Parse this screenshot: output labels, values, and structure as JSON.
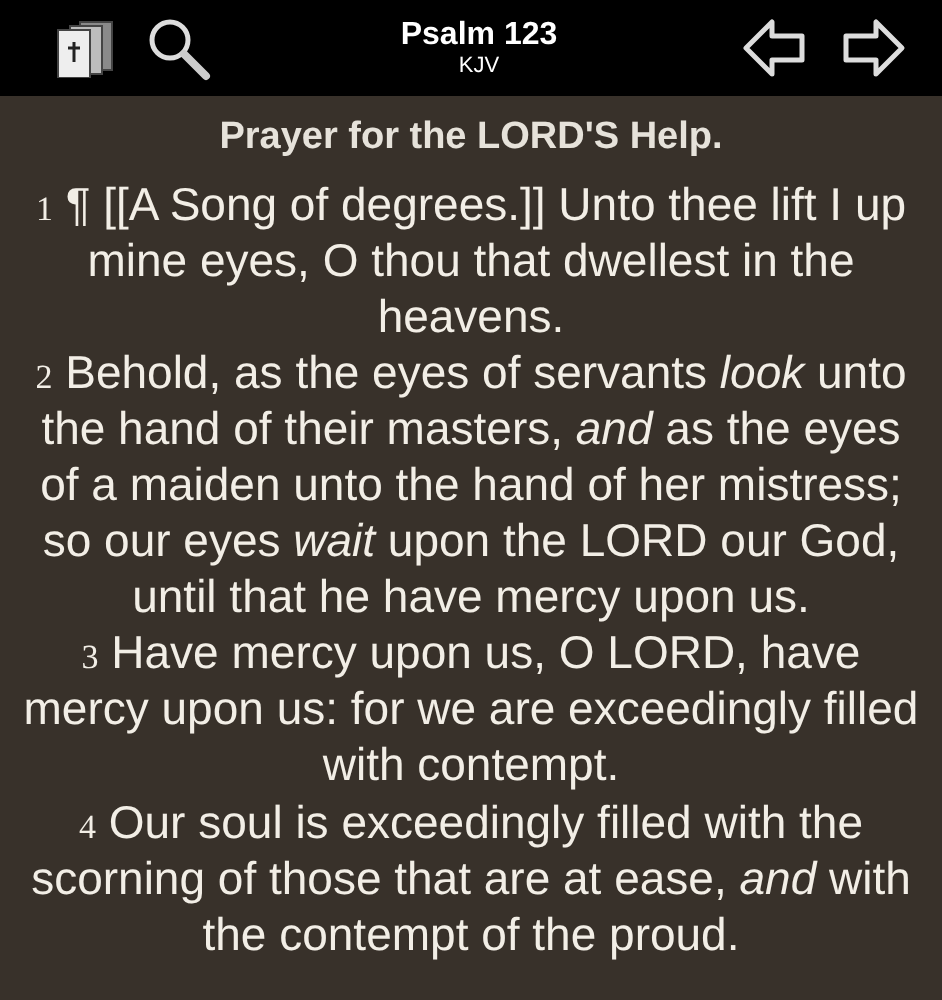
{
  "header": {
    "title": "Psalm 123",
    "subtitle": "KJV"
  },
  "heading": "Prayer for the LORD'S Help.",
  "verses": [
    {
      "number": "1",
      "text": "¶ [[A Song of degrees.]] Unto thee lift I up mine eyes, O thou that dwellest in the heavens."
    },
    {
      "number": "2",
      "text": "Behold, as the eyes of servants *look* unto the hand of their masters, *and* as the eyes of a maiden unto the hand of her mistress; so our eyes *wait* upon the LORD our God, until that he have mercy upon us."
    },
    {
      "number": "3",
      "text": "Have mercy upon us, O LORD, have mercy upon us: for we are exceedingly filled with contempt."
    },
    {
      "number": "4",
      "text": "Our soul is exceedingly filled with the scorning of those that are at ease, *and* with the contempt of the proud."
    }
  ]
}
